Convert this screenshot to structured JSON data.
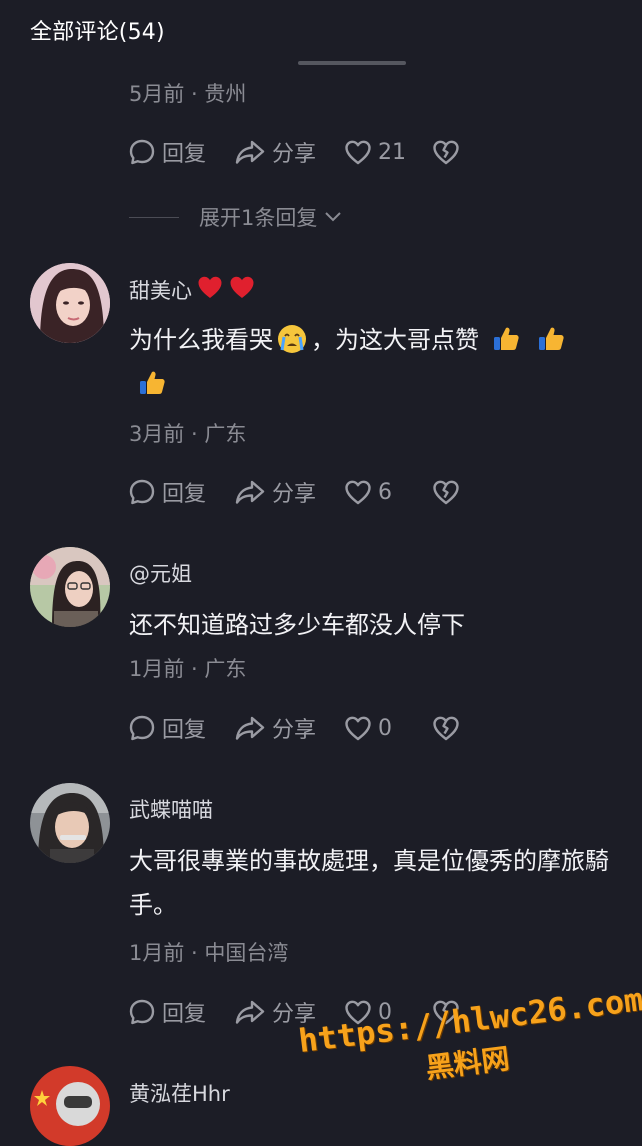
{
  "header": {
    "title": "全部评论(54)"
  },
  "colors": {
    "background": "#1c1d26",
    "heart_red": "#e0202e",
    "watermark": "#f7a21b"
  },
  "first_comment_tail": {
    "meta": "5月前 · 贵州",
    "actions": {
      "reply": "回复",
      "share": "分享",
      "like_count": "21"
    },
    "expand_label": "展开1条回复"
  },
  "comments": [
    {
      "username": "甜美心",
      "text_a": "为什么我看哭",
      "text_b": "，为这大哥点赞",
      "meta": "3月前 · 广东",
      "actions": {
        "reply": "回复",
        "share": "分享",
        "like_count": "6"
      }
    },
    {
      "username": "@元姐",
      "text": "还不知道路过多少车都没人停下",
      "meta": "1月前 · 广东",
      "actions": {
        "reply": "回复",
        "share": "分享",
        "like_count": "0"
      }
    },
    {
      "username": "武蝶喵喵",
      "text": "大哥很專業的事故處理，真是位優秀的摩旅騎手。",
      "meta": "1月前 · 中国台湾",
      "actions": {
        "reply": "回复",
        "share": "分享",
        "like_count": "0"
      }
    },
    {
      "username": "黄泓荏Hhr"
    }
  ],
  "watermark": {
    "url": "https://hlwc26.com",
    "name": "黑料网"
  }
}
